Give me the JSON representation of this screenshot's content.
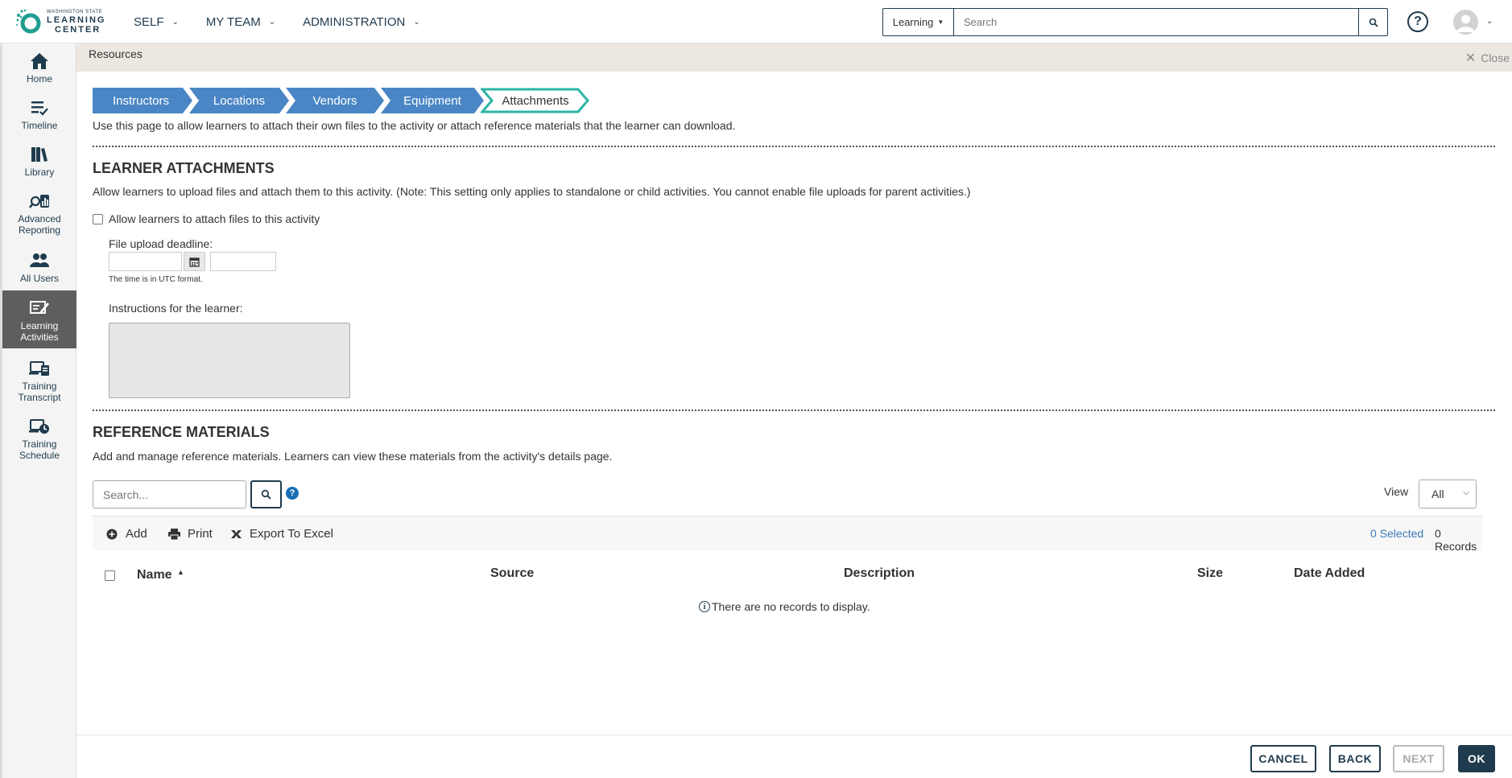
{
  "logo": {
    "line1": "WASHINGTON STATE",
    "line2": "LEARNING",
    "line3": "CENTER"
  },
  "topnav": [
    {
      "label": "SELF"
    },
    {
      "label": "MY TEAM"
    },
    {
      "label": "ADMINISTRATION"
    }
  ],
  "search": {
    "scope": "Learning",
    "placeholder": "Search"
  },
  "help": {
    "label": "?"
  },
  "sidebar": [
    {
      "label": "Home",
      "icon": "home-icon"
    },
    {
      "label": "Timeline",
      "icon": "timeline-icon"
    },
    {
      "label": "Library",
      "icon": "library-icon"
    },
    {
      "label": "Advanced Reporting",
      "icon": "reporting-icon"
    },
    {
      "label": "All Users",
      "icon": "users-icon"
    },
    {
      "label": "Learning Activities",
      "icon": "learning-activities-icon",
      "active": true
    },
    {
      "label": "Training Transcript",
      "icon": "transcript-icon"
    },
    {
      "label": "Training Schedule",
      "icon": "schedule-icon"
    }
  ],
  "resources": {
    "title": "Resources",
    "close": "Close"
  },
  "steps": [
    "Instructors",
    "Locations",
    "Vendors",
    "Equipment",
    "Attachments"
  ],
  "intro": "Use this page to allow learners to attach their own files to the activity or attach reference materials that the learner can download.",
  "learner": {
    "heading": "LEARNER ATTACHMENTS",
    "desc": "Allow learners to upload files and attach them to this activity. (Note: This setting only applies to standalone or child activities. You cannot enable file uploads for parent activities.)",
    "checkbox": "Allow learners to attach files to this activity",
    "deadline_label": "File upload deadline:",
    "utc_note": "The time is in UTC format.",
    "instructions_label": "Instructions for the learner:"
  },
  "reference": {
    "heading": "REFERENCE MATERIALS",
    "desc": "Add and manage reference materials. Learners can view these materials from the activity's details page.",
    "search_placeholder": "Search...",
    "view_label": "View",
    "view_value": "All",
    "toolbar": {
      "add": "Add",
      "print": "Print",
      "export": "Export To Excel"
    },
    "selected": "0 Selected",
    "records": "0 Records",
    "columns": [
      "Name",
      "Source",
      "Description",
      "Size",
      "Date Added"
    ],
    "empty": "There are no records to display."
  },
  "footer": {
    "cancel": "CANCEL",
    "back": "BACK",
    "next": "NEXT",
    "ok": "OK"
  },
  "colors": {
    "primary": "#1f3b4d",
    "step_blue": "#4a86c5",
    "step_active_border": "#2bb5a5",
    "resource_bar": "#ece8e1"
  }
}
